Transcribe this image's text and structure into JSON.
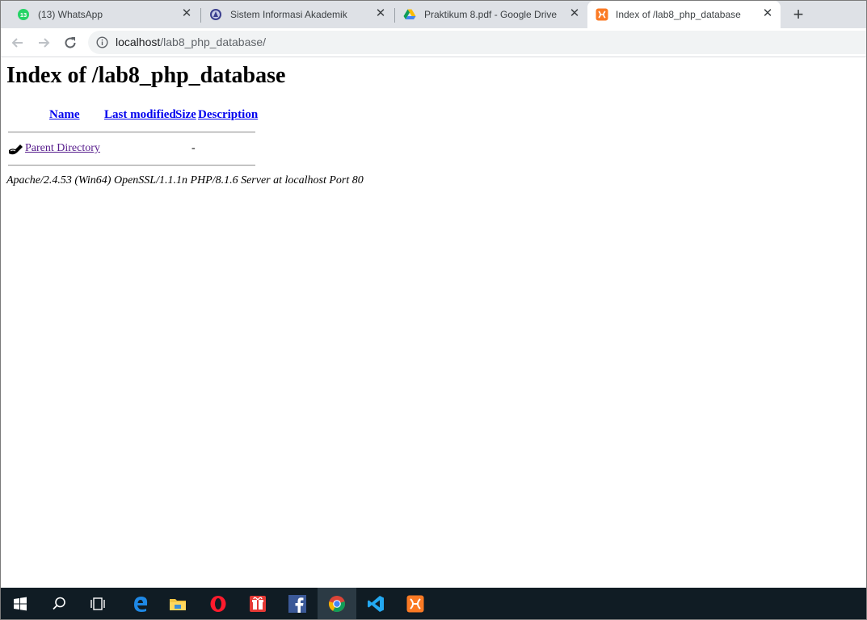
{
  "browser": {
    "tabs": [
      {
        "title": "(13) WhatsApp",
        "badge": "13",
        "icon": "whatsapp-icon",
        "active": false
      },
      {
        "title": "Sistem Informasi Akademik",
        "icon": "university-icon",
        "active": false
      },
      {
        "title": "Praktikum 8.pdf - Google Drive",
        "icon": "google-drive-icon",
        "active": false
      },
      {
        "title": "Index of /lab8_php_database",
        "icon": "xampp-icon",
        "active": true
      }
    ],
    "url_host": "localhost",
    "url_path": "/lab8_php_database/"
  },
  "page": {
    "heading": "Index of /lab8_php_database",
    "columns": [
      "Name",
      "Last modified",
      "Size",
      "Description"
    ],
    "rows": [
      {
        "name": "Parent Directory",
        "last_modified": "",
        "size": "-",
        "description": "",
        "icon": "back-folder-icon"
      }
    ],
    "address": "Apache/2.4.53 (Win64) OpenSSL/1.1.1n PHP/8.1.6 Server at localhost Port 80"
  },
  "taskbar": {
    "items": [
      "start-icon",
      "search-icon",
      "task-view-icon",
      "edge-icon",
      "file-explorer-icon",
      "opera-icon",
      "gift-app-icon",
      "facebook-icon",
      "chrome-icon",
      "vscode-icon",
      "xampp-icon"
    ],
    "active": "chrome-icon"
  },
  "colors": {
    "tabstrip": "#dee1e6",
    "link": "#0000ee",
    "visited": "#551a8b",
    "taskbar": "#101c24"
  }
}
